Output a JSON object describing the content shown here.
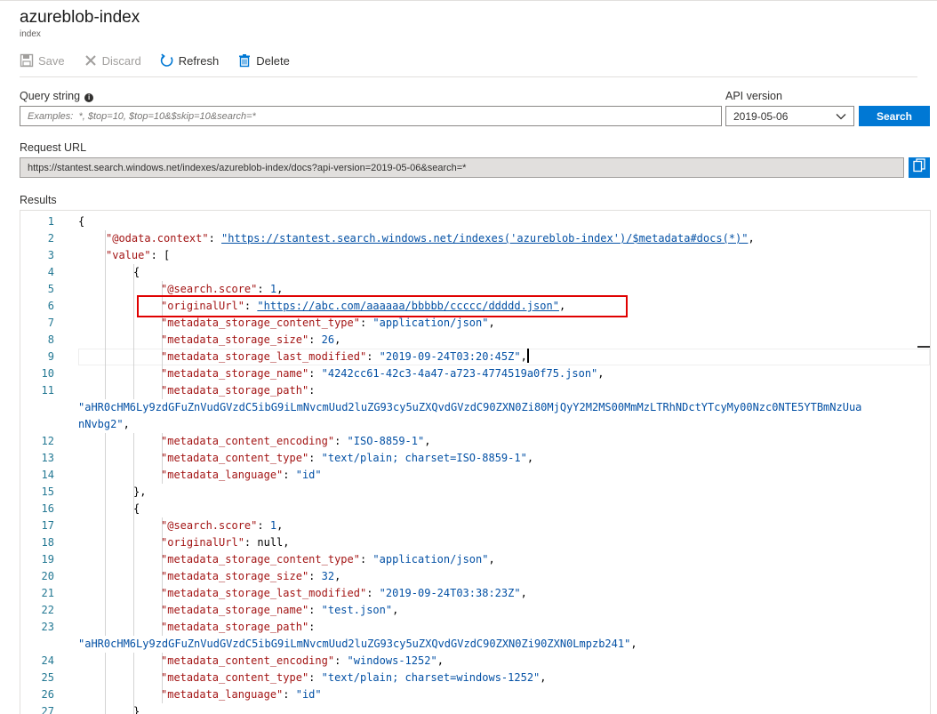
{
  "header": {
    "title": "azureblob-index",
    "subtitle": "index"
  },
  "toolbar": {
    "save": "Save",
    "discard": "Discard",
    "refresh": "Refresh",
    "delete": "Delete"
  },
  "query": {
    "label": "Query string",
    "info": "i",
    "placeholder": "Examples:  *, $top=10, $top=10&$skip=10&search=*",
    "value": ""
  },
  "api": {
    "label": "API version",
    "selected": "2019-05-06",
    "search_button": "Search"
  },
  "request": {
    "label": "Request URL",
    "url": "https://stantest.search.windows.net/indexes/azureblob-index/docs?api-version=2019-05-06&search=*"
  },
  "results": {
    "label": "Results",
    "lines": [
      {
        "n": "1",
        "indent": 0,
        "tokens": [
          [
            "p",
            "{"
          ]
        ]
      },
      {
        "n": "2",
        "indent": 1,
        "tokens": [
          [
            "k",
            "\"@odata.context\""
          ],
          [
            "p",
            ": "
          ],
          [
            "u",
            "\"https://stantest.search.windows.net/indexes('azureblob-index')/$metadata#docs(*)\""
          ],
          [
            "p",
            ","
          ]
        ]
      },
      {
        "n": "3",
        "indent": 1,
        "tokens": [
          [
            "k",
            "\"value\""
          ],
          [
            "p",
            ": ["
          ]
        ]
      },
      {
        "n": "4",
        "indent": 2,
        "tokens": [
          [
            "p",
            "{"
          ]
        ]
      },
      {
        "n": "5",
        "indent": 3,
        "tokens": [
          [
            "k",
            "\"@search.score\""
          ],
          [
            "p",
            ": "
          ],
          [
            "s",
            "1"
          ],
          [
            "p",
            ","
          ]
        ]
      },
      {
        "n": "6",
        "indent": 3,
        "tokens": [
          [
            "k",
            "\"originalUrl\""
          ],
          [
            "p",
            ": "
          ],
          [
            "u",
            "\"https://abc.com/aaaaaa/bbbbb/ccccc/ddddd.json\""
          ],
          [
            "p",
            ","
          ]
        ]
      },
      {
        "n": "7",
        "indent": 3,
        "tokens": [
          [
            "k",
            "\"metadata_storage_content_type\""
          ],
          [
            "p",
            ": "
          ],
          [
            "s",
            "\"application/json\""
          ],
          [
            "p",
            ","
          ]
        ]
      },
      {
        "n": "8",
        "indent": 3,
        "tokens": [
          [
            "k",
            "\"metadata_storage_size\""
          ],
          [
            "p",
            ": "
          ],
          [
            "s",
            "26"
          ],
          [
            "p",
            ","
          ]
        ]
      },
      {
        "n": "9",
        "indent": 3,
        "tokens": [
          [
            "k",
            "\"metadata_storage_last_modified\""
          ],
          [
            "p",
            ": "
          ],
          [
            "s",
            "\"2019-09-24T03:20:45Z\""
          ],
          [
            "p",
            ","
          ]
        ],
        "cursor": true
      },
      {
        "n": "10",
        "indent": 3,
        "tokens": [
          [
            "k",
            "\"metadata_storage_name\""
          ],
          [
            "p",
            ": "
          ],
          [
            "s",
            "\"4242cc61-42c3-4a47-a723-4774519a0f75.json\""
          ],
          [
            "p",
            ","
          ]
        ]
      },
      {
        "n": "11",
        "indent": 3,
        "tokens": [
          [
            "k",
            "\"metadata_storage_path\""
          ],
          [
            "p",
            ":"
          ]
        ]
      },
      {
        "n": "",
        "indent": 0,
        "tokens": [
          [
            "s",
            "\"aHR0cHM6Ly9zdGFuZnVudGVzdC5ibG9iLmNvcmUud2luZG93cy5uZXQvdGVzdC90ZXN0Zi80MjQyY2M2MS00MmMzLTRhNDctYTcyMy00Nzc0NTE5YTBmNzUua"
          ]
        ]
      },
      {
        "n": "",
        "indent": 0,
        "tokens": [
          [
            "s",
            "nNvbg2\""
          ],
          [
            "p",
            ","
          ]
        ]
      },
      {
        "n": "12",
        "indent": 3,
        "tokens": [
          [
            "k",
            "\"metadata_content_encoding\""
          ],
          [
            "p",
            ": "
          ],
          [
            "s",
            "\"ISO-8859-1\""
          ],
          [
            "p",
            ","
          ]
        ]
      },
      {
        "n": "13",
        "indent": 3,
        "tokens": [
          [
            "k",
            "\"metadata_content_type\""
          ],
          [
            "p",
            ": "
          ],
          [
            "s",
            "\"text/plain; charset=ISO-8859-1\""
          ],
          [
            "p",
            ","
          ]
        ]
      },
      {
        "n": "14",
        "indent": 3,
        "tokens": [
          [
            "k",
            "\"metadata_language\""
          ],
          [
            "p",
            ": "
          ],
          [
            "s",
            "\"id\""
          ]
        ]
      },
      {
        "n": "15",
        "indent": 2,
        "tokens": [
          [
            "p",
            "},"
          ]
        ]
      },
      {
        "n": "16",
        "indent": 2,
        "tokens": [
          [
            "p",
            "{"
          ]
        ]
      },
      {
        "n": "17",
        "indent": 3,
        "tokens": [
          [
            "k",
            "\"@search.score\""
          ],
          [
            "p",
            ": "
          ],
          [
            "s",
            "1"
          ],
          [
            "p",
            ","
          ]
        ]
      },
      {
        "n": "18",
        "indent": 3,
        "tokens": [
          [
            "k",
            "\"originalUrl\""
          ],
          [
            "p",
            ": null,"
          ]
        ]
      },
      {
        "n": "19",
        "indent": 3,
        "tokens": [
          [
            "k",
            "\"metadata_storage_content_type\""
          ],
          [
            "p",
            ": "
          ],
          [
            "s",
            "\"application/json\""
          ],
          [
            "p",
            ","
          ]
        ]
      },
      {
        "n": "20",
        "indent": 3,
        "tokens": [
          [
            "k",
            "\"metadata_storage_size\""
          ],
          [
            "p",
            ": "
          ],
          [
            "s",
            "32"
          ],
          [
            "p",
            ","
          ]
        ]
      },
      {
        "n": "21",
        "indent": 3,
        "tokens": [
          [
            "k",
            "\"metadata_storage_last_modified\""
          ],
          [
            "p",
            ": "
          ],
          [
            "s",
            "\"2019-09-24T03:38:23Z\""
          ],
          [
            "p",
            ","
          ]
        ]
      },
      {
        "n": "22",
        "indent": 3,
        "tokens": [
          [
            "k",
            "\"metadata_storage_name\""
          ],
          [
            "p",
            ": "
          ],
          [
            "s",
            "\"test.json\""
          ],
          [
            "p",
            ","
          ]
        ]
      },
      {
        "n": "23",
        "indent": 3,
        "tokens": [
          [
            "k",
            "\"metadata_storage_path\""
          ],
          [
            "p",
            ":"
          ]
        ]
      },
      {
        "n": "",
        "indent": 0,
        "tokens": [
          [
            "s",
            "\"aHR0cHM6Ly9zdGFuZnVudGVzdC5ibG9iLmNvcmUud2luZG93cy5uZXQvdGVzdC90ZXN0Zi90ZXN0Lmpzb241\""
          ],
          [
            "p",
            ","
          ]
        ]
      },
      {
        "n": "24",
        "indent": 3,
        "tokens": [
          [
            "k",
            "\"metadata_content_encoding\""
          ],
          [
            "p",
            ": "
          ],
          [
            "s",
            "\"windows-1252\""
          ],
          [
            "p",
            ","
          ]
        ]
      },
      {
        "n": "25",
        "indent": 3,
        "tokens": [
          [
            "k",
            "\"metadata_content_type\""
          ],
          [
            "p",
            ": "
          ],
          [
            "s",
            "\"text/plain; charset=windows-1252\""
          ],
          [
            "p",
            ","
          ]
        ]
      },
      {
        "n": "26",
        "indent": 3,
        "tokens": [
          [
            "k",
            "\"metadata_language\""
          ],
          [
            "p",
            ": "
          ],
          [
            "s",
            "\"id\""
          ]
        ]
      },
      {
        "n": "27",
        "indent": 2,
        "tokens": [
          [
            "p",
            "}"
          ]
        ]
      }
    ]
  },
  "colors": {
    "accent": "#0078d4",
    "key": "#a31515",
    "string": "#0451a5",
    "line_number": "#237893",
    "highlight_box": "#e00000"
  },
  "icons": {
    "save": "save-icon",
    "discard": "close-icon",
    "refresh": "refresh-icon",
    "delete": "trash-icon",
    "copy": "copy-icon",
    "dropdown": "chevron-down-icon"
  }
}
